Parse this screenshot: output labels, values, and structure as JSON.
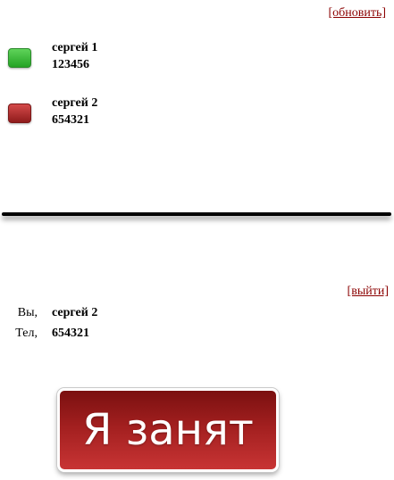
{
  "header": {
    "refresh_label": "[обновить]"
  },
  "contacts": [
    {
      "name": "сергей 1",
      "phone": "123456",
      "status": "free",
      "status_color": "#2fb52f"
    },
    {
      "name": "сергей 2",
      "phone": "654321",
      "status": "busy",
      "status_color": "#b22a2a"
    }
  ],
  "session": {
    "logout_label": "[выйти]",
    "you_label": "Вы,",
    "you_value": "сергей 2",
    "phone_label": "Тел,",
    "phone_value": "654321"
  },
  "action": {
    "busy_button_label": "Я занят",
    "busy_button_color": "#a21f1f"
  }
}
